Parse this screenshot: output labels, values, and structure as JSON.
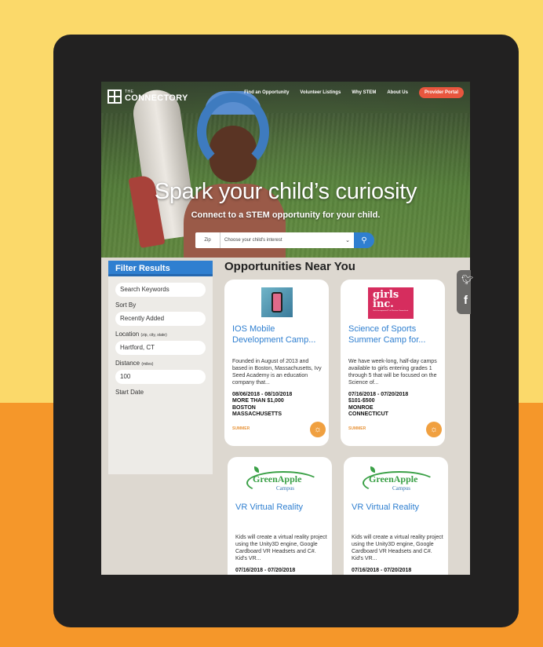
{
  "header": {
    "logo_small": "THE",
    "logo_big": "CONNECTORY",
    "nav": [
      "Find an Opportunity",
      "Volunteer Listings",
      "Why STEM",
      "About Us"
    ],
    "portal_label": "Provider Portal"
  },
  "hero": {
    "title": "Spark your child’s curiosity",
    "subtitle": "Connect to a STEM opportunity for your child.",
    "zip_placeholder": "Zip",
    "interest_placeholder": "Choose your child's interest"
  },
  "filter": {
    "heading": "Filter Results",
    "keywords_placeholder": "Search Keywords",
    "sort_label": "Sort By",
    "sort_value": "Recently Added",
    "location_label": "Location",
    "location_hint": "(zip, city, state)",
    "location_value": "Hartford, CT",
    "distance_label": "Distance",
    "distance_hint": "(miles)",
    "distance_value": "100",
    "start_label": "Start Date"
  },
  "main": {
    "heading": "Opportunities Near You",
    "cards": [
      {
        "title_line1": "IOS Mobile",
        "title_line2": "Development Camp...",
        "desc": "Founded in August of 2013 and based in Boston, Massachusetts, Ivy Seed Academy is an education company that...",
        "dates": "08/06/2018 - 08/10/2018",
        "price": "MORE THAN $1,000",
        "city": "BOSTON",
        "state": "MASSACHUSETTS",
        "season": "SUMMER"
      },
      {
        "title_line1": "Science of Sports",
        "title_line2": "Summer Camp for...",
        "logo_main": "girls inc.",
        "logo_sub": "Girls Incorporated® of Western Connecticut",
        "desc": "We have week-long, half-day camps available to girls entering grades 1 through 5 that will be focused on the Science of...",
        "dates": "07/16/2018 - 07/20/2018",
        "price": "$101-$500",
        "city": "MONROE",
        "state": "CONNECTICUT",
        "season": "SUMMER"
      },
      {
        "title_line1": "VR Virtual Reality",
        "logo_main": "GreenApple",
        "logo_sub": "Campus",
        "desc": "Kids will create a virtual reality project using the Unity3D engine, Google Cardboard VR Headsets and C#. Kid's VR...",
        "dates": "07/16/2018 - 07/20/2018"
      },
      {
        "title_line1": "VR Virtual Reality",
        "logo_main": "GreenApple",
        "logo_sub": "Campus",
        "desc": "Kids will create a virtual reality project using the Unity3D engine, Google Cardboard VR Headsets and C#. Kid's VR...",
        "dates": "07/16/2018 - 07/20/2018"
      }
    ]
  },
  "social": {
    "icons": [
      "twitter-icon",
      "facebook-icon"
    ]
  },
  "colors": {
    "background_top": "#fbd96a",
    "background_bottom": "#f5972a",
    "accent_blue": "#2f7fd0",
    "portal_red": "#e8563e"
  }
}
